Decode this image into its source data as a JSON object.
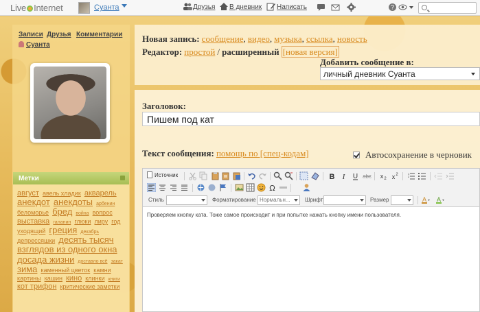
{
  "topbar": {
    "logo": "LiveInternet",
    "user": "Суанта",
    "nav": [
      "Друзья",
      "В дневник",
      "Написать"
    ],
    "search_placeholder": ""
  },
  "sidebar": {
    "links": [
      "Записи",
      "Друзья",
      "Комментарии"
    ],
    "owner": "Суанта",
    "tags_title": "Метки",
    "tags": [
      {
        "t": "август",
        "s": 2
      },
      {
        "t": "авель хладик",
        "s": 1
      },
      {
        "t": "акварель",
        "s": 2
      },
      {
        "t": "анекдот",
        "s": 3
      },
      {
        "t": "анекдоты",
        "s": 3
      },
      {
        "t": "арбенин",
        "s": 4
      },
      {
        "t": "беломорье",
        "s": 1
      },
      {
        "t": "бред",
        "s": 3
      },
      {
        "t": "война",
        "s": 4
      },
      {
        "t": "вопрос",
        "s": 1
      },
      {
        "t": "выставка",
        "s": 2
      },
      {
        "t": "галанин",
        "s": 4
      },
      {
        "t": "глюки",
        "s": 1
      },
      {
        "t": "лиру",
        "s": 1
      },
      {
        "t": "год",
        "s": 1
      },
      {
        "t": "уходящий",
        "s": 1
      },
      {
        "t": "греция",
        "s": 3
      },
      {
        "t": "декабрь",
        "s": 4
      },
      {
        "t": "депрессяшки",
        "s": 1
      },
      {
        "t": "десять тысяч",
        "s": 3
      },
      {
        "t": "взглядов из одного окна",
        "s": 3
      },
      {
        "t": "досада жизни",
        "s": 3
      },
      {
        "t": "доставло всё",
        "s": 4
      },
      {
        "t": "закат",
        "s": 4
      },
      {
        "t": "зима",
        "s": 3
      },
      {
        "t": "каменный цветок",
        "s": 1
      },
      {
        "t": "камни",
        "s": 1
      },
      {
        "t": "картины",
        "s": 1
      },
      {
        "t": "кашин",
        "s": 1
      },
      {
        "t": "кино",
        "s": 2
      },
      {
        "t": "клинки",
        "s": 1
      },
      {
        "t": "книги",
        "s": 4
      },
      {
        "t": "кот трифон",
        "s": 2
      },
      {
        "t": "критические заметки",
        "s": 1
      }
    ]
  },
  "main": {
    "new_entry_label": "Новая запись:",
    "entry_types": [
      "сообщение",
      "видео",
      "музыка",
      "ссылка",
      "новость"
    ],
    "editor_label": "Редактор:",
    "editor_simple": "простой",
    "editor_separator": "/",
    "editor_extended": "расширенный",
    "editor_new_version": "[новая версия]",
    "add_to_label": "Добавить сообщение в:",
    "diary_select": "личный дневник Суанта",
    "title_label": "Заголовок:",
    "title_value": "Пишем под кат",
    "text_label": "Текст сообщения:",
    "help_link": "помощь по [спец-кодам]",
    "autosave_label": "Автосохранение в черновик",
    "autosave_checked": true,
    "toolbar": {
      "source": "Источник",
      "style_label": "Стиль",
      "format_label": "Форматирование",
      "format_value": "Нормальн...",
      "font_label": "Шрифт",
      "size_label": "Размер"
    },
    "body_text": "Проверяем кнопку ката. Тоже самое происходит и при попытке нажать кнопку имени пользователя."
  }
}
